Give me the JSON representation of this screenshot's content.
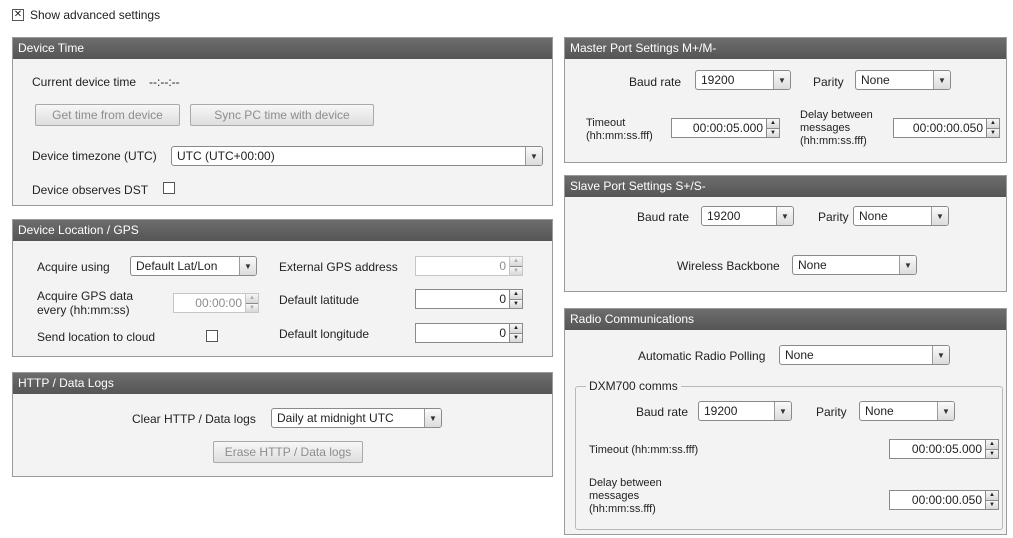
{
  "advanced": {
    "label": "Show advanced settings",
    "checked": true,
    "check_glyph": "✕"
  },
  "device_time": {
    "title": "Device Time",
    "current_label": "Current device time",
    "current_value": "--:--:--",
    "get_time_button": "Get time from device",
    "sync_button": "Sync PC time with device",
    "timezone_label": "Device timezone (UTC)",
    "timezone_value": "UTC (UTC+00:00)",
    "dst_label": "Device observes DST"
  },
  "location": {
    "title": "Device Location / GPS",
    "acquire_label": "Acquire using",
    "acquire_value": "Default Lat/Lon",
    "interval_label_1": "Acquire GPS data",
    "interval_label_2": "every (hh:mm:ss)",
    "interval_value": "00:00:00",
    "cloud_label": "Send location to cloud",
    "ext_gps_label": "External GPS address",
    "ext_gps_value": "0",
    "lat_label": "Default latitude",
    "lat_value": "0",
    "lon_label": "Default longitude",
    "lon_value": "0"
  },
  "http_logs": {
    "title": "HTTP / Data Logs",
    "clear_label": "Clear HTTP / Data logs",
    "clear_value": "Daily at midnight UTC",
    "erase_button": "Erase HTTP / Data logs"
  },
  "master_port": {
    "title": "Master Port Settings M+/M-",
    "baud_label": "Baud rate",
    "baud_value": "19200",
    "parity_label": "Parity",
    "parity_value": "None",
    "timeout_label_1": "Timeout",
    "timeout_label_2": "(hh:mm:ss.fff)",
    "timeout_value": "00:00:05.000",
    "delay_label_1": "Delay between",
    "delay_label_2": "messages",
    "delay_label_3": "(hh:mm:ss.fff)",
    "delay_value": "00:00:00.050"
  },
  "slave_port": {
    "title": "Slave Port Settings S+/S-",
    "baud_label": "Baud rate",
    "baud_value": "19200",
    "parity_label": "Parity",
    "parity_value": "None",
    "backbone_label": "Wireless Backbone",
    "backbone_value": "None"
  },
  "radio": {
    "title": "Radio Communications",
    "polling_label": "Automatic Radio Polling",
    "polling_value": "None",
    "dxm_group": "DXM700 comms",
    "baud_label": "Baud rate",
    "baud_value": "19200",
    "parity_label": "Parity",
    "parity_value": "None",
    "timeout_label": "Timeout (hh:mm:ss.fff)",
    "timeout_value": "00:00:05.000",
    "delay_label_1": "Delay between",
    "delay_label_2": "messages",
    "delay_label_3": "(hh:mm:ss.fff)",
    "delay_value": "00:00:00.050"
  },
  "icons": {
    "dropdown": "▼",
    "spin_up": "▲",
    "spin_down": "▼"
  }
}
